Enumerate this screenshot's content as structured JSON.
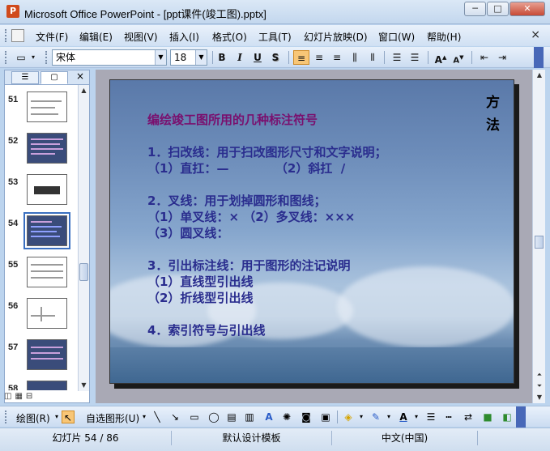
{
  "window": {
    "title": "Microsoft Office PowerPoint - [ppt课件(竣工图).pptx]",
    "min_label": "─",
    "max_label": "□",
    "close_label": "✕"
  },
  "menu": {
    "items": [
      "文件(F)",
      "编辑(E)",
      "视图(V)",
      "插入(I)",
      "格式(O)",
      "工具(T)",
      "幻灯片放映(D)",
      "窗口(W)",
      "帮助(H)"
    ],
    "close_label": "×"
  },
  "toolbar": {
    "font_name": "宋体",
    "font_size": "18",
    "bold_label": "B",
    "italic_label": "I",
    "underline_label": "U",
    "shadow_label": "S"
  },
  "outline_pane": {
    "close_label": "×",
    "slides": [
      {
        "num": "51"
      },
      {
        "num": "52"
      },
      {
        "num": "53"
      },
      {
        "num": "54"
      },
      {
        "num": "55"
      },
      {
        "num": "56"
      },
      {
        "num": "57"
      },
      {
        "num": "58"
      }
    ],
    "selected": "54"
  },
  "slide": {
    "side_title_1": "方",
    "side_title_2": "法",
    "heading": "编绘竣工图所用的几种标注符号",
    "lines": [
      "1．扫改线：用于扫改图形尺寸和文字说明；",
      "（1）直扛：—           （2）斜扛  /",
      "2．叉线：用于划掉圆形和图线；",
      "（1）单叉线：× （2）多叉线：×××",
      "（3）圆叉线：",
      "3．引出标注线：用于图形的注记说明",
      "（1）直线型引出线",
      "（2）折线型引出线",
      "4．索引符号与引出线"
    ]
  },
  "drawbar": {
    "draw_label": "绘图(R)",
    "autoshapes_label": "自选图形(U)"
  },
  "status": {
    "slide_info": "幻灯片 54 / 86",
    "template": "默认设计模板",
    "language": "中文(中国)"
  }
}
